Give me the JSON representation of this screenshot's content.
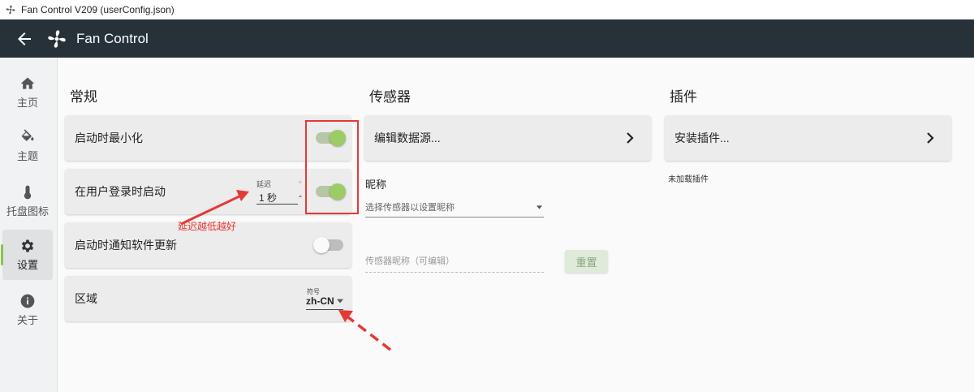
{
  "window": {
    "title": "Fan Control V209 (userConfig.json)"
  },
  "appbar": {
    "title": "Fan Control"
  },
  "sidebar": {
    "items": [
      {
        "label": "主页",
        "icon": "home-icon"
      },
      {
        "label": "主题",
        "icon": "paint-bucket-icon"
      },
      {
        "label": "托盘图标",
        "icon": "thermometer-icon"
      },
      {
        "label": "设置",
        "icon": "gear-icon",
        "active": true
      },
      {
        "label": "关于",
        "icon": "info-icon"
      }
    ]
  },
  "general": {
    "title": "常规",
    "start_minimized": {
      "label": "启动时最小化",
      "on": true
    },
    "start_on_login": {
      "label": "在用户登录时启动",
      "on": true,
      "delay_label": "延迟",
      "delay_value": "1 秒",
      "minus": "-",
      "plus": "+"
    },
    "notify_update": {
      "label": "启动时通知软件更新",
      "on": false
    },
    "region": {
      "label": "区域",
      "symbol_label": "符号",
      "value": "zh-CN"
    }
  },
  "sensors": {
    "title": "传感器",
    "edit_sources": "编辑数据源...",
    "nickname_title": "昵称",
    "select_placeholder": "选择传感器以设置昵称",
    "nickname_placeholder": "传感器昵称（可编辑）",
    "reset_label": "重置"
  },
  "plugins": {
    "title": "插件",
    "install": "安装插件...",
    "none_loaded": "未加载插件"
  },
  "annotation": {
    "text": "延迟越低越好",
    "color": "#e53935"
  },
  "colors": {
    "appbar": "#263238",
    "accent": "#9ccc65"
  }
}
